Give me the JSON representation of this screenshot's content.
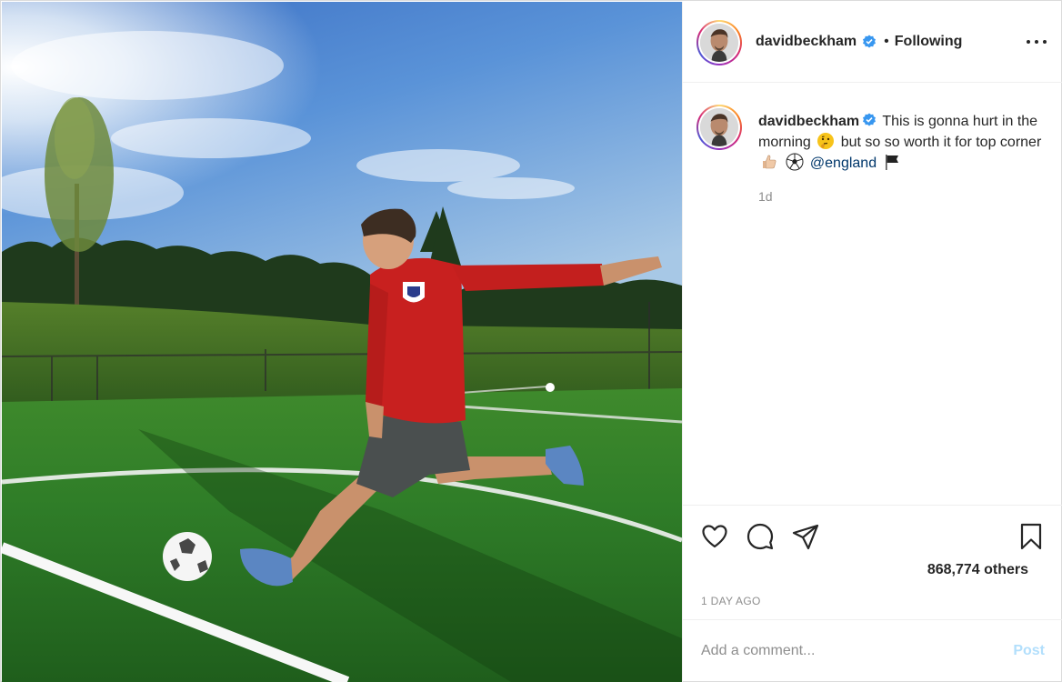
{
  "post": {
    "image_alt": "Man in red England jersey kicking a football on an artificial pitch",
    "author": {
      "username": "davidbeckham",
      "verified": true,
      "follow_state": "Following",
      "separator": "•"
    },
    "caption": {
      "username": "davidbeckham",
      "text_1": "This is gonna hurt in the morning",
      "emoji_1": "thinking-face-emoji",
      "text_2": "but so so worth it for top corner",
      "emoji_2": "thumbs-up-emoji",
      "emoji_3": "soccer-ball-emoji",
      "mention": "@england",
      "emoji_4": "black-flag-emoji",
      "time": "1d"
    },
    "likes": "868,774 others",
    "timestamp": "1 DAY AGO"
  },
  "comment_box": {
    "placeholder": "Add a comment...",
    "post_label": "Post"
  },
  "colors": {
    "verified_blue": "#3897f0",
    "post_button_disabled": "#b2dffc",
    "mention": "#00376b",
    "muted_text": "#8e8e8e"
  },
  "icons": [
    "heart-icon",
    "comment-icon",
    "share-icon",
    "bookmark-icon",
    "more-options-icon",
    "verified-badge-icon"
  ]
}
